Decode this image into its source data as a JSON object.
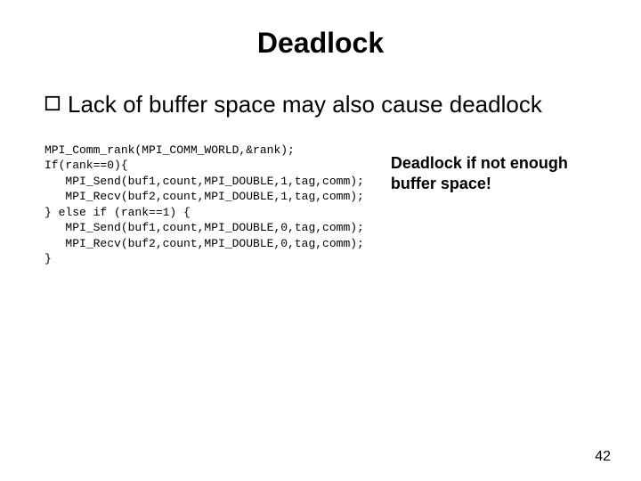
{
  "title": "Deadlock",
  "bullet": "Lack of buffer space may also cause deadlock",
  "code_lines": [
    "MPI_Comm_rank(MPI_COMM_WORLD,&rank);",
    "If(rank==0){",
    "   MPI_Send(buf1,count,MPI_DOUBLE,1,tag,comm);",
    "   MPI_Recv(buf2,count,MPI_DOUBLE,1,tag,comm);",
    "} else if (rank==1) {",
    "   MPI_Send(buf1,count,MPI_DOUBLE,0,tag,comm);",
    "   MPI_Recv(buf2,count,MPI_DOUBLE,0,tag,comm);",
    "}"
  ],
  "annotation": "Deadlock if not enough buffer space!",
  "page_number": "42"
}
